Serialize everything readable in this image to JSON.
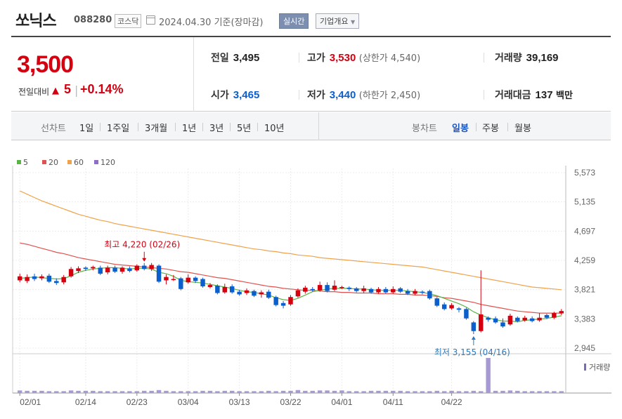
{
  "header": {
    "name": "쏘닉스",
    "code": "088280",
    "market": "코스닥",
    "date": "2024.04.30 기준(장마감)",
    "realtime_button": "실시간",
    "company_button": "기업개요"
  },
  "quote": {
    "price": "3,500",
    "change_label": "전일대비",
    "change_arrow": "▲",
    "change_value": "5",
    "change_sep": "|",
    "change_pct": "+0.14%",
    "prev_close_label": "전일",
    "prev_close": "3,495",
    "high_label": "고가",
    "high": "3,530",
    "upper_limit": "(상한가 4,540)",
    "volume_label": "거래량",
    "volume": "39,169",
    "open_label": "시가",
    "open": "3,465",
    "low_label": "저가",
    "low": "3,440",
    "lower_limit": "(하한가 2,450)",
    "amount_label": "거래대금",
    "amount": "137",
    "amount_unit": "백만"
  },
  "toolbar": {
    "line_chart_label": "선차트",
    "periods": [
      "1일",
      "1주일",
      "3개월",
      "1년",
      "3년",
      "5년",
      "10년"
    ],
    "candle_chart_label": "봉차트",
    "candles": [
      "일봉",
      "주봉",
      "월봉"
    ],
    "active_candle": "일봉"
  },
  "colors": {
    "up": "#d4000f",
    "down": "#0b5fcc",
    "ma5": "#5bb347",
    "ma20": "#e0524f",
    "ma60": "#f0a24a",
    "ma120": "#8f6cc7",
    "volume": "#a79ad4"
  },
  "chart_data": {
    "type": "candlestick",
    "legend": [
      "5",
      "20",
      "60",
      "120"
    ],
    "y_ticks": [
      "5,573",
      "5,135",
      "4,697",
      "4,259",
      "3,821",
      "3,383",
      "2,945"
    ],
    "y_range": [
      2945,
      5573
    ],
    "x_ticks": [
      "02/01",
      "02/14",
      "02/23",
      "03/04",
      "03/13",
      "03/22",
      "04/01",
      "04/11",
      "04/22"
    ],
    "annotation_high": "최고 4,220 (02/26)",
    "annotation_low": "최저 3,155 (04/16)",
    "volume_label": "거래량",
    "candles": [
      {
        "o": 3960,
        "c": 4020,
        "h": 4060,
        "l": 3930
      },
      {
        "o": 3950,
        "c": 4010,
        "h": 4050,
        "l": 3920
      },
      {
        "o": 4020,
        "c": 3980,
        "h": 4060,
        "l": 3950
      },
      {
        "o": 3990,
        "c": 4020,
        "h": 4050,
        "l": 3960
      },
      {
        "o": 4030,
        "c": 3940,
        "h": 4060,
        "l": 3920
      },
      {
        "o": 3950,
        "c": 3920,
        "h": 3990,
        "l": 3890
      },
      {
        "o": 3930,
        "c": 4010,
        "h": 4040,
        "l": 3900
      },
      {
        "o": 4020,
        "c": 4130,
        "h": 4160,
        "l": 4000
      },
      {
        "o": 4100,
        "c": 4140,
        "h": 4170,
        "l": 4070
      },
      {
        "o": 4150,
        "c": 4130,
        "h": 4170,
        "l": 4100
      },
      {
        "o": 4140,
        "c": 4160,
        "h": 4180,
        "l": 4110
      },
      {
        "o": 4150,
        "c": 4060,
        "h": 4180,
        "l": 4040
      },
      {
        "o": 4080,
        "c": 4150,
        "h": 4180,
        "l": 4050
      },
      {
        "o": 4150,
        "c": 4090,
        "h": 4180,
        "l": 4070
      },
      {
        "o": 4090,
        "c": 4150,
        "h": 4170,
        "l": 4060
      },
      {
        "o": 4140,
        "c": 4100,
        "h": 4170,
        "l": 4080
      },
      {
        "o": 4110,
        "c": 4180,
        "h": 4200,
        "l": 4090
      },
      {
        "o": 4180,
        "c": 4130,
        "h": 4220,
        "l": 4110
      },
      {
        "o": 4130,
        "c": 4190,
        "h": 4220,
        "l": 4100
      },
      {
        "o": 4180,
        "c": 3940,
        "h": 4200,
        "l": 3920
      },
      {
        "o": 3960,
        "c": 4010,
        "h": 4050,
        "l": 3900
      },
      {
        "o": 3980,
        "c": 3980,
        "h": 4040,
        "l": 3950
      },
      {
        "o": 3990,
        "c": 3830,
        "h": 4010,
        "l": 3810
      },
      {
        "o": 3930,
        "c": 4000,
        "h": 4050,
        "l": 3910
      },
      {
        "o": 4000,
        "c": 3950,
        "h": 4020,
        "l": 3920
      },
      {
        "o": 3980,
        "c": 3870,
        "h": 4000,
        "l": 3850
      },
      {
        "o": 3860,
        "c": 3890,
        "h": 3920,
        "l": 3840
      },
      {
        "o": 3880,
        "c": 3770,
        "h": 3900,
        "l": 3750
      },
      {
        "o": 3780,
        "c": 3860,
        "h": 3910,
        "l": 3760
      },
      {
        "o": 3870,
        "c": 3780,
        "h": 3900,
        "l": 3760
      },
      {
        "o": 3790,
        "c": 3750,
        "h": 3820,
        "l": 3730
      },
      {
        "o": 3770,
        "c": 3810,
        "h": 3840,
        "l": 3740
      },
      {
        "o": 3800,
        "c": 3730,
        "h": 3820,
        "l": 3710
      },
      {
        "o": 3750,
        "c": 3780,
        "h": 3810,
        "l": 3700
      },
      {
        "o": 3790,
        "c": 3700,
        "h": 3820,
        "l": 3680
      },
      {
        "o": 3710,
        "c": 3590,
        "h": 3730,
        "l": 3570
      },
      {
        "o": 3620,
        "c": 3580,
        "h": 3650,
        "l": 3540
      },
      {
        "o": 3600,
        "c": 3710,
        "h": 3740,
        "l": 3580
      },
      {
        "o": 3720,
        "c": 3810,
        "h": 3840,
        "l": 3700
      },
      {
        "o": 3790,
        "c": 3850,
        "h": 3880,
        "l": 3760
      },
      {
        "o": 3830,
        "c": 3820,
        "h": 3860,
        "l": 3790
      },
      {
        "o": 3810,
        "c": 3890,
        "h": 3940,
        "l": 3790
      },
      {
        "o": 3890,
        "c": 3800,
        "h": 3930,
        "l": 3780
      },
      {
        "o": 3820,
        "c": 3880,
        "h": 3960,
        "l": 3800
      },
      {
        "o": 3860,
        "c": 3860,
        "h": 3880,
        "l": 3830
      },
      {
        "o": 3850,
        "c": 3830,
        "h": 3870,
        "l": 3800
      },
      {
        "o": 3840,
        "c": 3800,
        "h": 3860,
        "l": 3780
      },
      {
        "o": 3800,
        "c": 3840,
        "h": 3880,
        "l": 3770
      },
      {
        "o": 3830,
        "c": 3780,
        "h": 3850,
        "l": 3760
      },
      {
        "o": 3780,
        "c": 3830,
        "h": 3860,
        "l": 3760
      },
      {
        "o": 3830,
        "c": 3780,
        "h": 3860,
        "l": 3760
      },
      {
        "o": 3780,
        "c": 3830,
        "h": 3870,
        "l": 3760
      },
      {
        "o": 3840,
        "c": 3790,
        "h": 3860,
        "l": 3770
      },
      {
        "o": 3800,
        "c": 3760,
        "h": 3830,
        "l": 3740
      },
      {
        "o": 3760,
        "c": 3800,
        "h": 3830,
        "l": 3740
      },
      {
        "o": 3790,
        "c": 3780,
        "h": 3810,
        "l": 3750
      },
      {
        "o": 3800,
        "c": 3690,
        "h": 3820,
        "l": 3670
      },
      {
        "o": 3690,
        "c": 3580,
        "h": 3710,
        "l": 3560
      },
      {
        "o": 3600,
        "c": 3530,
        "h": 3630,
        "l": 3510
      },
      {
        "o": 3540,
        "c": 3590,
        "h": 3620,
        "l": 3520
      },
      {
        "o": 3540,
        "c": 3520,
        "h": 3560,
        "l": 3480
      },
      {
        "o": 3530,
        "c": 3390,
        "h": 3550,
        "l": 3370
      },
      {
        "o": 3330,
        "c": 3200,
        "h": 3350,
        "l": 3155
      },
      {
        "o": 3200,
        "c": 3450,
        "h": 4110,
        "l": 3180
      },
      {
        "o": 3400,
        "c": 3370,
        "h": 3420,
        "l": 3340
      },
      {
        "o": 3390,
        "c": 3330,
        "h": 3420,
        "l": 3310
      },
      {
        "o": 3330,
        "c": 3270,
        "h": 3390,
        "l": 3250
      },
      {
        "o": 3300,
        "c": 3430,
        "h": 3460,
        "l": 3280
      },
      {
        "o": 3400,
        "c": 3350,
        "h": 3420,
        "l": 3330
      },
      {
        "o": 3360,
        "c": 3400,
        "h": 3430,
        "l": 3340
      },
      {
        "o": 3390,
        "c": 3350,
        "h": 3420,
        "l": 3330
      },
      {
        "o": 3360,
        "c": 3400,
        "h": 3470,
        "l": 3340
      },
      {
        "o": 3440,
        "c": 3400,
        "h": 3460,
        "l": 3380
      },
      {
        "o": 3400,
        "c": 3470,
        "h": 3490,
        "l": 3380
      },
      {
        "o": 3465,
        "c": 3500,
        "h": 3530,
        "l": 3440
      }
    ],
    "ma5": [
      3990,
      4000,
      4010,
      4000,
      3990,
      3980,
      3985,
      4030,
      4080,
      4110,
      4130,
      4140,
      4150,
      4150,
      4140,
      4130,
      4140,
      4140,
      4130,
      4080,
      4060,
      4020,
      3960,
      3940,
      3930,
      3920,
      3900,
      3880,
      3860,
      3840,
      3810,
      3790,
      3780,
      3760,
      3740,
      3700,
      3670,
      3660,
      3690,
      3740,
      3790,
      3810,
      3830,
      3840,
      3840,
      3840,
      3830,
      3830,
      3820,
      3810,
      3810,
      3810,
      3810,
      3800,
      3790,
      3780,
      3760,
      3730,
      3690,
      3650,
      3610,
      3560,
      3490,
      3440,
      3400,
      3370,
      3350,
      3350,
      3340,
      3360,
      3370,
      3380,
      3390,
      3410,
      3430
    ],
    "ma20": [
      4520,
      4500,
      4470,
      4440,
      4410,
      4380,
      4360,
      4330,
      4300,
      4280,
      4260,
      4240,
      4220,
      4200,
      4190,
      4180,
      4170,
      4160,
      4150,
      4140,
      4130,
      4110,
      4090,
      4080,
      4060,
      4040,
      4020,
      4000,
      3990,
      3970,
      3950,
      3930,
      3910,
      3890,
      3870,
      3860,
      3840,
      3830,
      3820,
      3810,
      3810,
      3800,
      3790,
      3790,
      3780,
      3780,
      3770,
      3770,
      3770,
      3760,
      3760,
      3760,
      3750,
      3750,
      3740,
      3740,
      3730,
      3720,
      3700,
      3690,
      3670,
      3650,
      3630,
      3600,
      3580,
      3560,
      3540,
      3520,
      3500,
      3490,
      3480,
      3470,
      3470,
      3470,
      3470
    ],
    "ma60": [
      5300,
      5250,
      5200,
      5150,
      5110,
      5070,
      5030,
      4990,
      4950,
      4920,
      4890,
      4860,
      4840,
      4810,
      4790,
      4770,
      4750,
      4730,
      4710,
      4690,
      4670,
      4650,
      4630,
      4610,
      4590,
      4570,
      4550,
      4530,
      4510,
      4490,
      4470,
      4450,
      4430,
      4420,
      4400,
      4390,
      4370,
      4360,
      4340,
      4330,
      4320,
      4300,
      4290,
      4280,
      4270,
      4260,
      4250,
      4240,
      4230,
      4220,
      4210,
      4200,
      4190,
      4180,
      4170,
      4160,
      4140,
      4120,
      4100,
      4080,
      4060,
      4040,
      4020,
      4000,
      3980,
      3960,
      3940,
      3920,
      3900,
      3880,
      3860,
      3850,
      3840,
      3830,
      3820
    ],
    "volume": [
      7,
      6,
      6,
      6,
      5,
      5,
      5,
      7,
      6,
      6,
      6,
      5,
      5,
      5,
      5,
      5,
      5,
      6,
      6,
      8,
      6,
      5,
      5,
      5,
      5,
      6,
      6,
      5,
      6,
      6,
      5,
      5,
      5,
      5,
      6,
      5,
      6,
      6,
      8,
      6,
      6,
      7,
      7,
      6,
      7,
      5,
      5,
      5,
      6,
      6,
      6,
      6,
      6,
      5,
      5,
      5,
      5,
      6,
      5,
      6,
      5,
      5,
      6,
      5,
      95,
      6,
      6,
      7,
      6,
      5,
      5,
      5,
      5,
      5,
      5
    ]
  }
}
